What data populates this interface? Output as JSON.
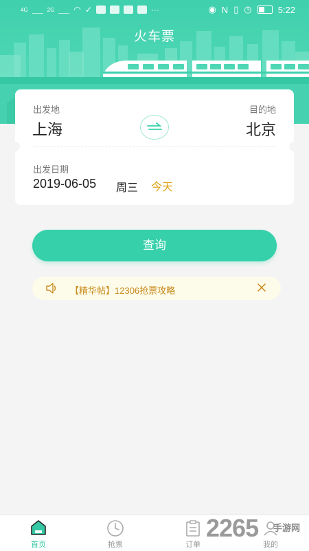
{
  "status_bar": {
    "left_indicators": [
      "4G",
      "2G"
    ],
    "time": "5:22"
  },
  "header": {
    "title": "火车票"
  },
  "ticket_form": {
    "from_label": "出发地",
    "from_city": "上海",
    "to_label": "目的地",
    "to_city": "北京",
    "date_label": "出发日期",
    "date_value": "2019-06-05",
    "weekday": "周三",
    "today_tag": "今天"
  },
  "search_button": {
    "label": "查询"
  },
  "notice": {
    "text": "【精华帖】12306抢票攻略"
  },
  "tabbar": {
    "items": [
      {
        "label": "首页",
        "icon": "home-icon",
        "active": true
      },
      {
        "label": "抢票",
        "icon": "clock-icon",
        "active": false
      },
      {
        "label": "订单",
        "icon": "order-icon",
        "active": false
      },
      {
        "label": "我的",
        "icon": "profile-icon",
        "active": false
      }
    ]
  },
  "watermark": {
    "number": "2265",
    "site": "手游网"
  },
  "colors": {
    "accent": "#36d0aa",
    "header_bg": "#4fd7b5",
    "today": "#e0a21a",
    "notice_text": "#c88a1b",
    "notice_bg": "#fdfbe9"
  }
}
